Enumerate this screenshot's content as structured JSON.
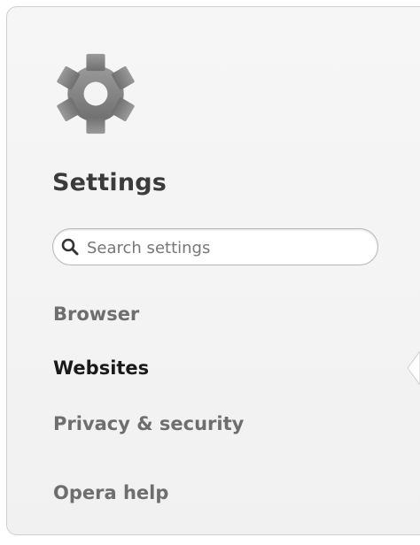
{
  "settings": {
    "icon": "gear-icon",
    "title": "Settings",
    "search": {
      "icon": "search-icon",
      "placeholder": "Search settings",
      "value": ""
    },
    "nav": [
      {
        "id": "browser",
        "label": "Browser",
        "active": false
      },
      {
        "id": "websites",
        "label": "Websites",
        "active": true
      },
      {
        "id": "privacy-security",
        "label": "Privacy & security",
        "active": false
      },
      {
        "id": "opera-help",
        "label": "Opera help",
        "active": false
      }
    ]
  },
  "colors": {
    "panel_bg": "#f4f4f4",
    "title": "#3b3b3b",
    "nav_inactive": "#6e6e6e",
    "nav_active": "#1a1a1a",
    "gear": "#8a8a8a"
  }
}
